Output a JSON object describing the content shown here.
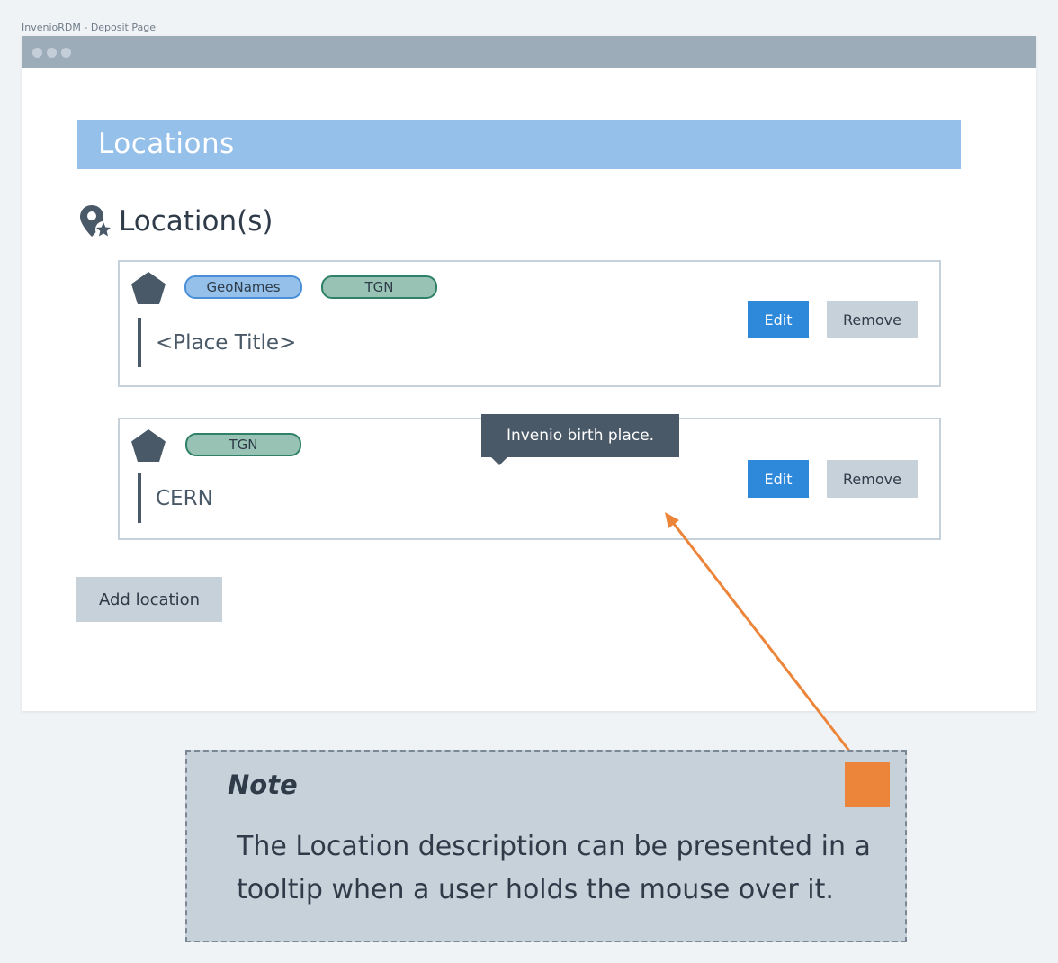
{
  "window": {
    "caption": "InvenioRDM - Deposit Page"
  },
  "section": {
    "title": "Locations"
  },
  "field": {
    "heading": "Location(s)",
    "icon": "map-marker-star-icon"
  },
  "locations": [
    {
      "badges": [
        "GeoNames",
        "TGN"
      ],
      "place": "<Place Title>",
      "edit_label": "Edit",
      "remove_label": "Remove"
    },
    {
      "badges": [
        "TGN"
      ],
      "place": "CERN",
      "edit_label": "Edit",
      "remove_label": "Remove",
      "tooltip": "Invenio birth place."
    }
  ],
  "add_button": "Add location",
  "note": {
    "title": "Note",
    "body": "The Location description can be presented in a tooltip when a user holds the mouse over it."
  },
  "colors": {
    "primary": "#2e89da",
    "section_bar": "#94c0ea",
    "geonames_badge": "#94c0ea",
    "tgn_badge": "#98c3b4",
    "note_bg": "#c6d1da",
    "note_marker": "#ec853a",
    "tooltip_bg": "#4a5967"
  }
}
